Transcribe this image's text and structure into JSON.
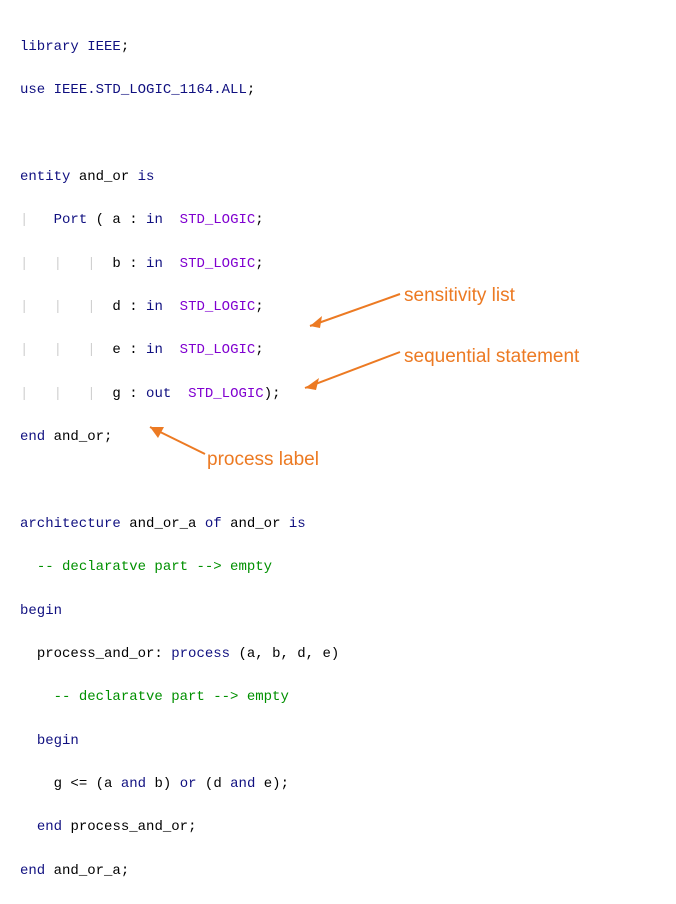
{
  "code": {
    "l1_kw_library": "library",
    "l1_id": "IEEE",
    "l1_sc": ";",
    "l2_kw_use": "use",
    "l2_lib": "IEEE.STD_LOGIC_1164.ALL",
    "l2_sc": ";",
    "l4_kw_entity": "entity",
    "l4_id": "and_or",
    "l4_kw_is": "is",
    "l5_kw_port": "Port",
    "l5_open": " (",
    "l5_sig": " a :",
    "l5_kw_in": "in",
    "l5_type": "STD_LOGIC",
    "l5_sc": ";",
    "l6_sig": "b :",
    "l6_kw_in": "in",
    "l6_type": "STD_LOGIC",
    "l6_sc": ";",
    "l7_sig": "d :",
    "l7_kw_in": "in",
    "l7_type": "STD_LOGIC",
    "l7_sc": ";",
    "l8_sig": "e :",
    "l8_kw_in": "in",
    "l8_type": "STD_LOGIC",
    "l8_sc": ";",
    "l9_sig": "g :",
    "l9_kw_out": "out",
    "l9_type": "STD_LOGIC",
    "l9_close": ");",
    "l10_kw_end": "end",
    "l10_id": "and_or",
    "l10_sc": ";",
    "l12_kw_arch": "architecture",
    "l12_id1": "and_or_a",
    "l12_kw_of": "of",
    "l12_id2": "and_or",
    "l12_kw_is": "is",
    "l13_cmt": "-- declaratve part --> empty",
    "l14_kw_begin": "begin",
    "l15_label": "process_and_or:",
    "l15_kw_process": "process",
    "l15_list": "(a, b, d, e)",
    "l16_cmt": "-- declaratve part --> empty",
    "l17_kw_begin": "begin",
    "l18_stmt_g": "g",
    "l18_le": "<=",
    "l18_op1": "(a",
    "l18_kw_and1": "and",
    "l18_b": "b)",
    "l18_kw_or": "or",
    "l18_op2": "(d",
    "l18_kw_and2": "and",
    "l18_e": "e)",
    "l18_sc": ";",
    "l19_kw_end": "end",
    "l19_id": "process_and_or",
    "l19_sc": ";",
    "l20_kw_end": "end",
    "l20_id": "and_or_a",
    "l20_sc": ";"
  },
  "annotations": {
    "sensitivity": "sensitivity list",
    "sequential": "sequential statement",
    "process_label": "process label"
  },
  "guides": {
    "v1": "|",
    "ind1": "    ",
    "ind2": "           "
  }
}
